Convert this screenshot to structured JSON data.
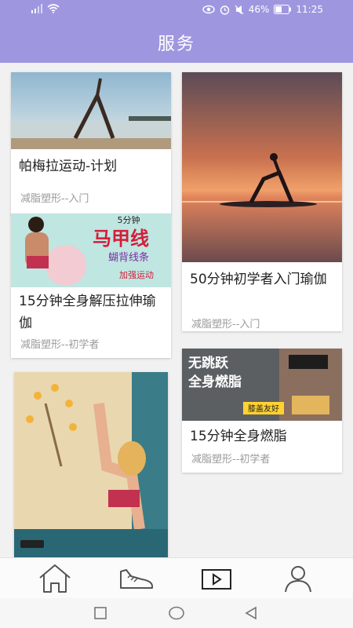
{
  "status_bar": {
    "signal": "signal-icon",
    "wifi": "wifi-icon",
    "battery_percent": "46%",
    "time": "11:25"
  },
  "header": {
    "title": "服务"
  },
  "cards": [
    {
      "title": "帕梅拉运动-计划",
      "subtitle": "减脂塑形--入门",
      "image_icon": "yoga-lake-image"
    },
    {
      "title": "50分钟初学者入门瑜伽",
      "subtitle": "减脂塑形--入门",
      "image_icon": "sunset-paddle-yoga-image"
    },
    {
      "title": "15分钟全身解压拉伸瑜伽",
      "subtitle": "减脂塑形--初学者",
      "image_icon": "vest-line-workout-image",
      "image_text": {
        "top": "5分钟",
        "main": "马甲线",
        "sub": "蝴背线条",
        "tag": "加强运动"
      }
    },
    {
      "title": "15分钟全身燃脂",
      "subtitle": "减脂塑形--初学者",
      "image_icon": "fat-burning-image",
      "image_text": {
        "main": "无跳跃\n全身燃脂",
        "tag": "膝盖友好"
      }
    },
    {
      "title": "",
      "subtitle": "",
      "image_icon": "yoga-illustration-image"
    }
  ],
  "bottom_nav": [
    {
      "name": "home",
      "icon": "home-icon"
    },
    {
      "name": "sport",
      "icon": "shoe-icon"
    },
    {
      "name": "video",
      "icon": "play-icon"
    },
    {
      "name": "profile",
      "icon": "person-icon"
    }
  ],
  "system_nav": [
    "square-icon",
    "circle-icon",
    "back-triangle-icon"
  ],
  "colors": {
    "header": "#9e97e0",
    "title": "#ffffff"
  }
}
